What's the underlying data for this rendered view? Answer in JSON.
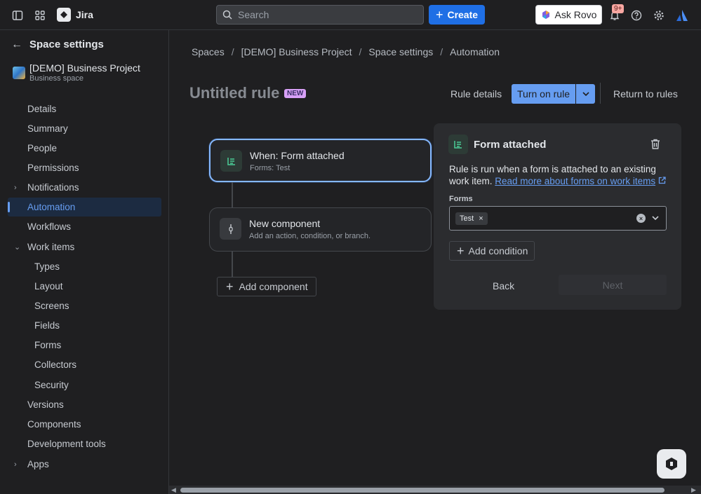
{
  "topbar": {
    "app_name": "Jira",
    "search_placeholder": "Search",
    "create_label": "Create",
    "ask_rovo_label": "Ask Rovo",
    "notifications_badge": "9+"
  },
  "sidebar": {
    "title": "Space settings",
    "project_name": "[DEMO] Business Project",
    "project_sub": "Business space",
    "items": [
      {
        "label": "Details"
      },
      {
        "label": "Summary"
      },
      {
        "label": "People"
      },
      {
        "label": "Permissions"
      },
      {
        "label": "Notifications"
      },
      {
        "label": "Automation"
      },
      {
        "label": "Workflows"
      },
      {
        "label": "Work items"
      },
      {
        "label": "Types"
      },
      {
        "label": "Layout"
      },
      {
        "label": "Screens"
      },
      {
        "label": "Fields"
      },
      {
        "label": "Forms"
      },
      {
        "label": "Collectors"
      },
      {
        "label": "Security"
      },
      {
        "label": "Versions"
      },
      {
        "label": "Components"
      },
      {
        "label": "Development tools"
      },
      {
        "label": "Apps"
      }
    ]
  },
  "breadcrumb": [
    "Spaces",
    "[DEMO] Business Project",
    "Space settings",
    "Automation"
  ],
  "header": {
    "rule_title": "Untitled rule",
    "new_badge": "NEW",
    "rule_details": "Rule details",
    "turn_on": "Turn on rule",
    "return_to_rules": "Return to rules"
  },
  "canvas": {
    "trigger_title": "When: Form attached",
    "trigger_sub": "Forms: Test",
    "new_component_title": "New component",
    "new_component_sub": "Add an action, condition, or branch.",
    "add_component": "Add component"
  },
  "panel": {
    "title": "Form attached",
    "desc": "Rule is run when a form is attached to an existing work item. ",
    "link": "Read more about forms on work items",
    "forms_label": "Forms",
    "selected_tag": "Test",
    "add_condition": "Add condition",
    "back": "Back",
    "next": "Next"
  }
}
